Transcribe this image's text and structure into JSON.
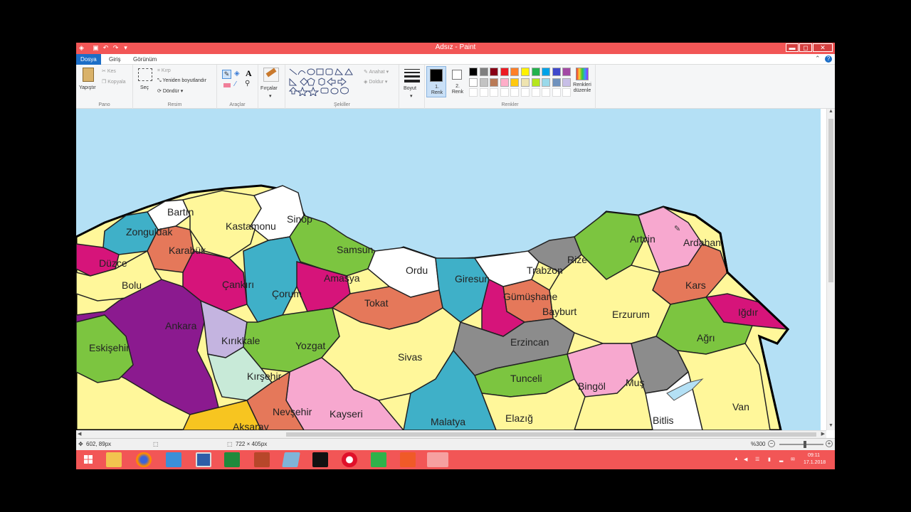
{
  "window": {
    "title": "Adsız - Paint",
    "controls": {
      "minimize": "▬",
      "maximize": "◻",
      "close": "✕"
    },
    "help": "?",
    "collapse": "⌃"
  },
  "tabs": {
    "file": "Dosya",
    "home": "Giriş",
    "view": "Görünüm"
  },
  "ribbon": {
    "clipboard": {
      "paste": "Yapıştır",
      "cut": "Kes",
      "copy": "Kopyala",
      "label": "Pano"
    },
    "image": {
      "select": "Seç",
      "crop": "Kırp",
      "resize": "Yeniden boyutlandır",
      "rotate": "Döndür",
      "label": "Resim"
    },
    "tools": {
      "label": "Araçlar",
      "text_glyph": "A"
    },
    "brushes": {
      "label": "Fırçalar"
    },
    "shapes": {
      "outline": "Anahat",
      "fill": "Doldur",
      "label": "Şekiller"
    },
    "size": {
      "label": "Boyut"
    },
    "colors": {
      "color1": "1. Renk",
      "color2": "2. Renk",
      "edit": "Renkleri düzenle",
      "label": "Renkler",
      "color1_value": "#000000",
      "color2_value": "#ffffff",
      "palette_row1": [
        "#000000",
        "#7f7f7f",
        "#880015",
        "#ed1c24",
        "#ff7f27",
        "#fff200",
        "#22b14c",
        "#00a2e8",
        "#3f48cc",
        "#a349a4"
      ],
      "palette_row2": [
        "#ffffff",
        "#c3c3c3",
        "#b97a57",
        "#ffaec9",
        "#ffc90e",
        "#efe4b0",
        "#b5e61d",
        "#99d9ea",
        "#7092be",
        "#c8bfe7"
      ]
    }
  },
  "map": {
    "sea_color": "#b4e0f5",
    "regions": [
      {
        "name": "Bartın",
        "color": "#ffffff"
      },
      {
        "name": "Zonguldak",
        "color": "#3fb0c8"
      },
      {
        "name": "Kastamonu",
        "color": "#fff79a"
      },
      {
        "name": "Sinop",
        "color": "#ffffff"
      },
      {
        "name": "Karabük",
        "color": "#e5785a"
      },
      {
        "name": "Düzce",
        "color": "#d6147a"
      },
      {
        "name": "Bolu",
        "color": "#fff79a"
      },
      {
        "name": "Çankırı",
        "color": "#d6147a"
      },
      {
        "name": "Samsun",
        "color": "#7cc540"
      },
      {
        "name": "Çorum",
        "color": "#3fb0c8"
      },
      {
        "name": "Amasya",
        "color": "#d6147a"
      },
      {
        "name": "Ordu",
        "color": "#ffffff"
      },
      {
        "name": "Giresun",
        "color": "#3fb0c8"
      },
      {
        "name": "Trabzon",
        "color": "#ffffff"
      },
      {
        "name": "Rize",
        "color": "#8c8c8c"
      },
      {
        "name": "Artvin",
        "color": "#7cc540"
      },
      {
        "name": "Ardahan",
        "color": "#f7a8cf"
      },
      {
        "name": "Kars",
        "color": "#e5785a"
      },
      {
        "name": "Iğdır",
        "color": "#d6147a"
      },
      {
        "name": "Ağrı",
        "color": "#7cc540"
      },
      {
        "name": "Erzurum",
        "color": "#fff79a"
      },
      {
        "name": "Bayburt",
        "color": "#e5785a"
      },
      {
        "name": "Gümüşhane",
        "color": "#d6147a"
      },
      {
        "name": "Tokat",
        "color": "#e5785a"
      },
      {
        "name": "Ankara",
        "color": "#8b1a8f"
      },
      {
        "name": "Kırıkkale",
        "color": "#c4b4e0"
      },
      {
        "name": "Yozgat",
        "color": "#7cc540"
      },
      {
        "name": "Kırşehir",
        "color": "#c8ead8"
      },
      {
        "name": "Sivas",
        "color": "#fff79a"
      },
      {
        "name": "Erzincan",
        "color": "#8c8c8c"
      },
      {
        "name": "Tunceli",
        "color": "#7cc540"
      },
      {
        "name": "Bingöl",
        "color": "#f7a8cf"
      },
      {
        "name": "Muş",
        "color": "#8c8c8c"
      },
      {
        "name": "Van",
        "color": "#fff79a"
      },
      {
        "name": "Bitlis",
        "color": "#ffffff"
      },
      {
        "name": "Elazığ",
        "color": "#fff79a"
      },
      {
        "name": "Malatya",
        "color": "#3fb0c8"
      },
      {
        "name": "Kayseri",
        "color": "#f7a8cf"
      },
      {
        "name": "Nevşehir",
        "color": "#e5785a"
      },
      {
        "name": "Eskişehir",
        "color": "#7cc540"
      },
      {
        "name": "Aksaray",
        "color": "#f7c520"
      }
    ]
  },
  "status": {
    "cursor_pos": "602, 89px",
    "image_size": "722 × 405px",
    "zoom": "%300",
    "zoom_out": "−",
    "zoom_in": "+"
  },
  "taskbar": {
    "time": "09:11",
    "date": "17.1.2018",
    "accent": "#f25656"
  }
}
